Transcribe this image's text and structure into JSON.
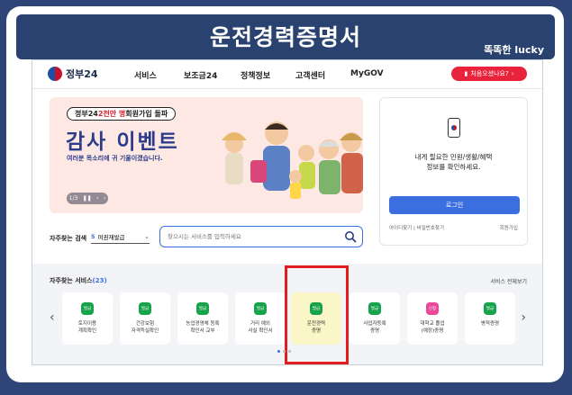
{
  "banner": {
    "title": "운전경력증명서",
    "brand": "똑똑한 lucky"
  },
  "nav": {
    "logo": "정부24",
    "items": [
      "서비스",
      "보조금24",
      "정책정보",
      "고객센터",
      "MyGOV"
    ],
    "cta": "처음오셨나요?"
  },
  "hero": {
    "pill_prefix": "정부24 ",
    "pill_red": "2천만 명",
    "pill_suffix": " 회원가입 돌파",
    "headline": "감사 이벤트",
    "sub": "여러분 목소리에 귀 기울이겠습니다.",
    "pager": "1/3"
  },
  "login": {
    "message_line1": "내게 필요한 민원/생활/혜택",
    "message_line2": "정보를 확인하세요.",
    "button": "로그인",
    "links": "아이디찾기 | 비밀번호찾기",
    "join": "회원가입"
  },
  "search": {
    "label": "자주찾는 검색",
    "select_num": "5",
    "select_value": "여권재발급",
    "placeholder": "찾으시는 서비스를 입력하세요"
  },
  "services": {
    "title": "자주찾는 서비스",
    "count": "(23)",
    "all": "서비스 전체보기",
    "items": [
      {
        "badge": "발급",
        "line1": "토지이용",
        "line2": "계획확인"
      },
      {
        "badge": "발급",
        "line1": "건강보험",
        "line2": "자격득실확인"
      },
      {
        "badge": "발급",
        "line1": "농업경영체 등록",
        "line2": "확인서 교부"
      },
      {
        "badge": "발급",
        "line1": "거리 예외",
        "line2": "사실 확인서"
      },
      {
        "badge": "발급",
        "line1": "운전경력",
        "line2": "증명"
      },
      {
        "badge": "발급",
        "line1": "사업자등록",
        "line2": "증명"
      },
      {
        "badge": "신청",
        "line1": "대학교 졸업",
        "line2": "(예정)증명"
      },
      {
        "badge": "발급",
        "line1": "병적증명",
        "line2": ""
      }
    ]
  },
  "colors": {
    "banner": "#29426f",
    "accent": "#3b6fe0",
    "cta": "#e8233b",
    "highlight": "#e11d1d"
  }
}
